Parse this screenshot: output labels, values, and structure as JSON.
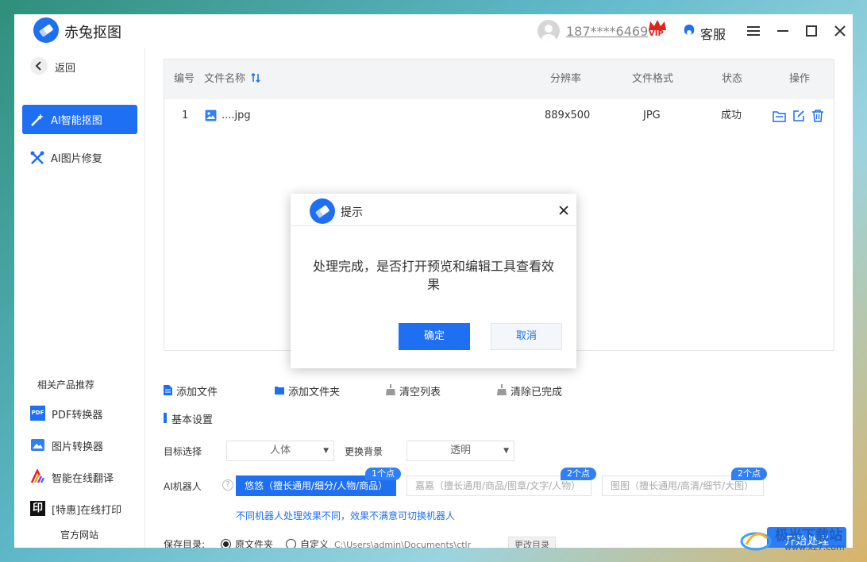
{
  "app": {
    "title": "赤兔抠图",
    "logo_icon": "eraser-icon",
    "brand_color": "#1f6ff2"
  },
  "titlebar": {
    "user_phone": "187****6469",
    "vip_label": "VIP",
    "service_label": "客服",
    "menu_icon": "hamburger-icon",
    "minimize_icon": "minimize-icon",
    "maximize_icon": "maximize-icon",
    "close_icon": "close-icon"
  },
  "sidebar": {
    "back_label": "返回",
    "items": [
      {
        "label": "AI智能抠图",
        "icon": "magic-wand-icon",
        "active": true
      },
      {
        "label": "AI图片修复",
        "icon": "tools-icon",
        "active": false
      }
    ],
    "recommend_title": "相关产品推荐",
    "products": [
      {
        "label": "PDF转换器",
        "icon": "pdf-icon"
      },
      {
        "label": "图片转换器",
        "icon": "image-convert-icon"
      },
      {
        "label": "智能在线翻译",
        "icon": "translate-icon"
      },
      {
        "label": "[特惠]在线打印",
        "icon": "print-icon"
      }
    ],
    "website_label": "官方网站"
  },
  "table": {
    "headers": {
      "no": "编号",
      "filename": "文件名称",
      "resolution": "分辨率",
      "format": "文件格式",
      "status": "状态",
      "actions": "操作"
    },
    "rows": [
      {
        "no": "1",
        "filename": "....jpg",
        "resolution": "889x500",
        "format": "JPG",
        "status": "成功"
      }
    ]
  },
  "toolbar": {
    "add_file": "添加文件",
    "add_folder": "添加文件夹",
    "clear_list": "清空列表",
    "clear_done": "清除已完成"
  },
  "settings": {
    "section_title": "基本设置",
    "target_label": "目标选择",
    "target_value": "人体",
    "bg_label": "更换背景",
    "bg_value": "透明",
    "robot_label": "AI机器人",
    "robots": [
      {
        "label": "悠悠（擅长通用/细分/人物/商品）",
        "points": "1个点",
        "active": true
      },
      {
        "label": "嘉嘉（擅长通用/商品/图章/文字/人物）",
        "points": "2个点",
        "active": false
      },
      {
        "label": "图图（擅长通用/高清/细节/大图）",
        "points": "2个点",
        "active": false
      }
    ],
    "robot_hint": "不同机器人处理效果不同，效果不满意可切换机器人",
    "save_label": "保存目录:",
    "save_opt_original": "原文件夹",
    "save_opt_custom": "自定义",
    "save_path": "C:\\Users\\admin\\Documents\\ctlr",
    "change_dir": "更改目录",
    "start_button": "开始处理"
  },
  "dialog": {
    "title": "提示",
    "message": "处理完成，是否打开预览和编辑工具查看效果",
    "ok": "确定",
    "cancel": "取消"
  },
  "watermark": {
    "text": "极光下载站",
    "url": "www.xz7.com"
  }
}
